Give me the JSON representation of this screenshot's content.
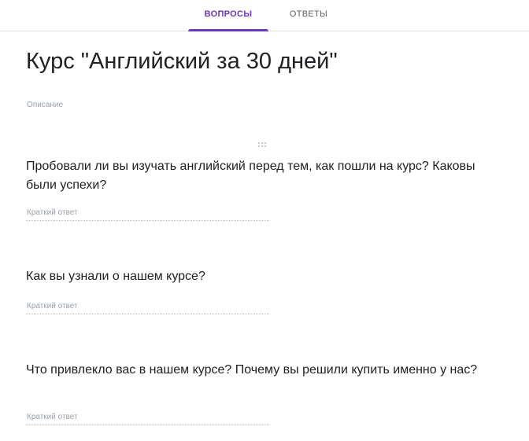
{
  "tabs": [
    {
      "label": "ВОПРОСЫ",
      "active": true
    },
    {
      "label": "ОТВЕТЫ",
      "active": false
    }
  ],
  "form": {
    "title": "Курс \"Английский за 30 дней\"",
    "description_placeholder": "Описание"
  },
  "questions": [
    {
      "text": "Пробовали ли вы изучать английский перед тем, как пошли на курс? Каковы были успехи?",
      "answer_placeholder": "Краткий ответ"
    },
    {
      "text": "Как вы узнали о нашем курсе?",
      "answer_placeholder": "Краткий ответ"
    },
    {
      "text": "Что привлекло вас в нашем курсе? Почему вы решили купить именно у нас?",
      "answer_placeholder": "Краткий ответ"
    }
  ],
  "icons": {
    "drag_handle": "drag-handle-icon"
  },
  "colors": {
    "accent": "#673ab7",
    "text": "#202124",
    "muted": "#9aa0a6"
  }
}
